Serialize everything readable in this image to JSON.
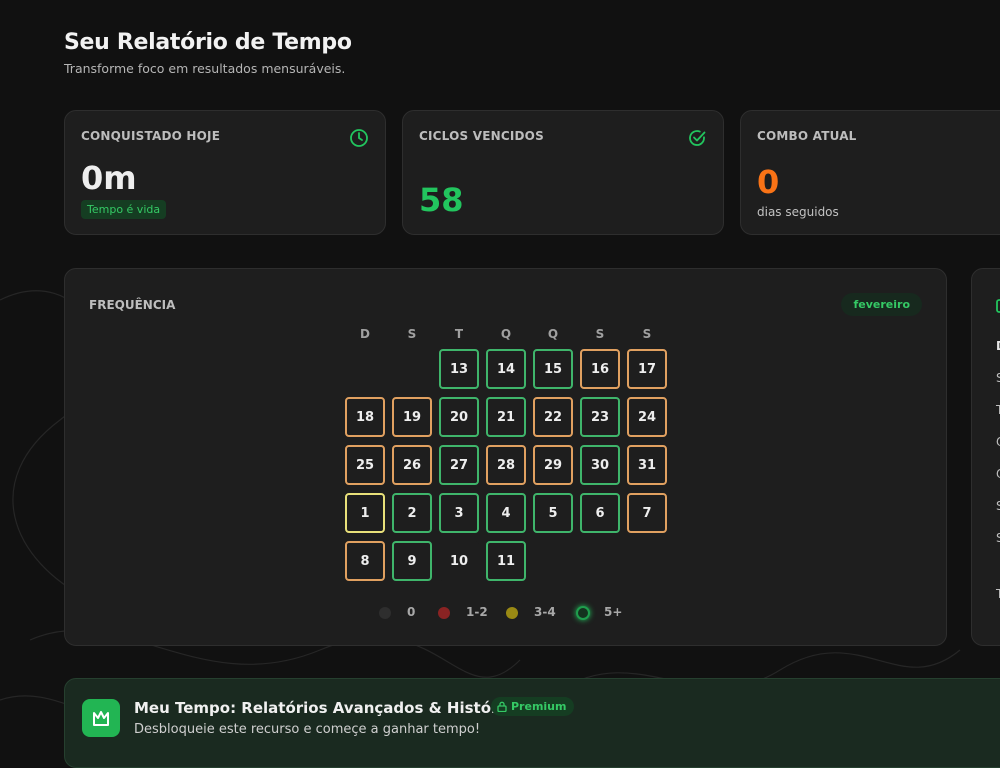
{
  "header": {
    "title": "Seu Relatório de Tempo",
    "subtitle": "Transforme foco em resultados mensuráveis."
  },
  "cards": {
    "today": {
      "label": "CONQUISTADO HOJE",
      "value": "0m",
      "badge": "Tempo é vida",
      "icon": "clock-icon"
    },
    "cycles": {
      "label": "CICLOS VENCIDOS",
      "value": "58",
      "icon": "check-circle-icon"
    },
    "combo": {
      "label": "COMBO ATUAL",
      "value": "0",
      "caption": "dias seguidos"
    }
  },
  "frequency": {
    "label": "FREQUÊNCIA",
    "month": "fevereiro",
    "weekdays": [
      "D",
      "S",
      "T",
      "Q",
      "Q",
      "S",
      "S"
    ],
    "days": [
      {
        "n": "13",
        "col": 2,
        "row": 0,
        "s": "g"
      },
      {
        "n": "14",
        "col": 3,
        "row": 0,
        "s": "g"
      },
      {
        "n": "15",
        "col": 4,
        "row": 0,
        "s": "g"
      },
      {
        "n": "16",
        "col": 5,
        "row": 0,
        "s": "o"
      },
      {
        "n": "17",
        "col": 6,
        "row": 0,
        "s": "o"
      },
      {
        "n": "18",
        "col": 0,
        "row": 1,
        "s": "o"
      },
      {
        "n": "19",
        "col": 1,
        "row": 1,
        "s": "o"
      },
      {
        "n": "20",
        "col": 2,
        "row": 1,
        "s": "g"
      },
      {
        "n": "21",
        "col": 3,
        "row": 1,
        "s": "g"
      },
      {
        "n": "22",
        "col": 4,
        "row": 1,
        "s": "o"
      },
      {
        "n": "23",
        "col": 5,
        "row": 1,
        "s": "g"
      },
      {
        "n": "24",
        "col": 6,
        "row": 1,
        "s": "o"
      },
      {
        "n": "25",
        "col": 0,
        "row": 2,
        "s": "o"
      },
      {
        "n": "26",
        "col": 1,
        "row": 2,
        "s": "o"
      },
      {
        "n": "27",
        "col": 2,
        "row": 2,
        "s": "g"
      },
      {
        "n": "28",
        "col": 3,
        "row": 2,
        "s": "o"
      },
      {
        "n": "29",
        "col": 4,
        "row": 2,
        "s": "o"
      },
      {
        "n": "30",
        "col": 5,
        "row": 2,
        "s": "g"
      },
      {
        "n": "31",
        "col": 6,
        "row": 2,
        "s": "o"
      },
      {
        "n": "1",
        "col": 0,
        "row": 3,
        "s": "y"
      },
      {
        "n": "2",
        "col": 1,
        "row": 3,
        "s": "g"
      },
      {
        "n": "3",
        "col": 2,
        "row": 3,
        "s": "g"
      },
      {
        "n": "4",
        "col": 3,
        "row": 3,
        "s": "g"
      },
      {
        "n": "5",
        "col": 4,
        "row": 3,
        "s": "g"
      },
      {
        "n": "6",
        "col": 5,
        "row": 3,
        "s": "g"
      },
      {
        "n": "7",
        "col": 6,
        "row": 3,
        "s": "o"
      },
      {
        "n": "8",
        "col": 0,
        "row": 4,
        "s": "o"
      },
      {
        "n": "9",
        "col": 1,
        "row": 4,
        "s": "g"
      },
      {
        "n": "10",
        "col": 2,
        "row": 4,
        "s": "n"
      },
      {
        "n": "11",
        "col": 3,
        "row": 4,
        "s": "g"
      }
    ],
    "legend": [
      {
        "label": "0",
        "color": "#2e2e2e"
      },
      {
        "label": "1-2",
        "color": "#8a2323"
      },
      {
        "label": "3-4",
        "color": "#9a8a14"
      },
      {
        "label": "5+",
        "color": "#14331f"
      }
    ]
  },
  "side_panel": {
    "letters": [
      "D",
      "S",
      "T",
      "Q",
      "Q",
      "S",
      "S",
      "T"
    ]
  },
  "banner": {
    "title": "Meu Tempo: Relatórios Avançados & Histórico",
    "badge": "Premium",
    "description": "Desbloqueie este recurso e começe a ganhar tempo!",
    "icon": "crown-icon"
  },
  "colors": {
    "accent_green": "#22c55e",
    "orange": "#f97316",
    "background": "#111111"
  }
}
